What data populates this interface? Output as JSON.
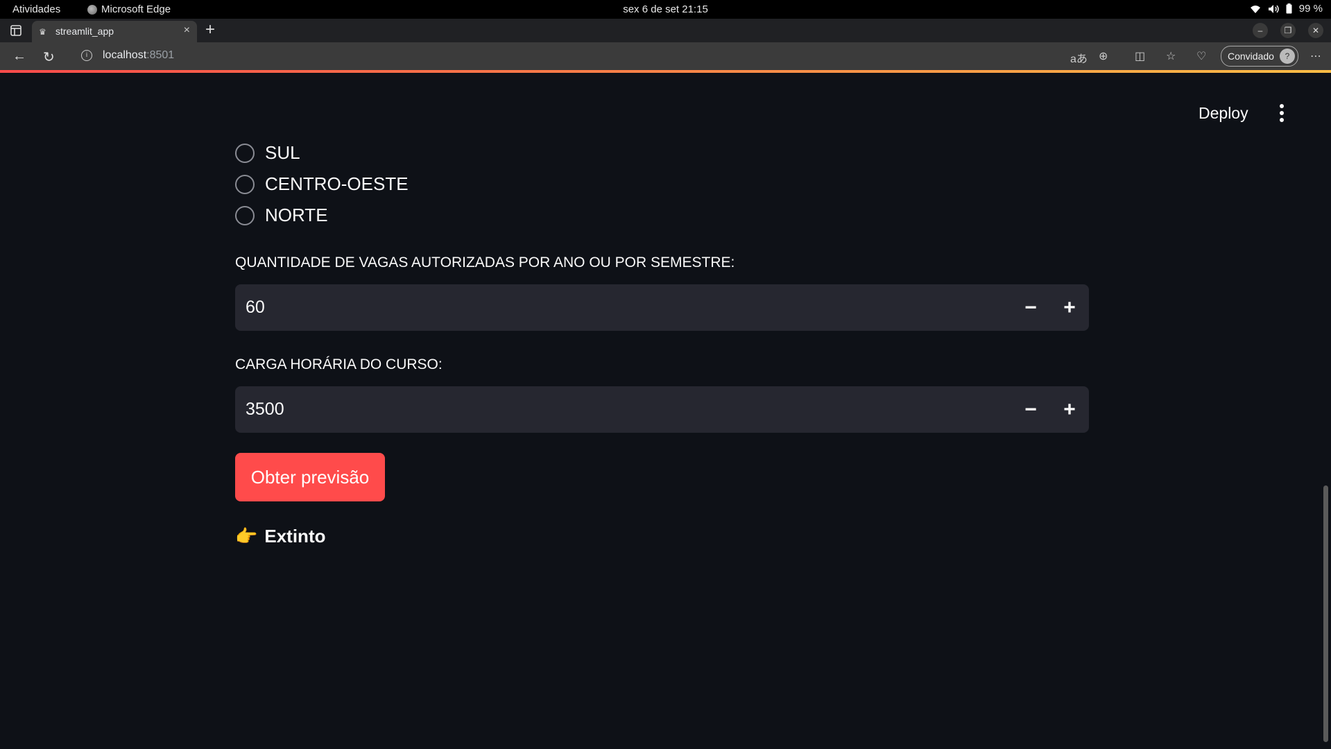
{
  "os_bar": {
    "activities": "Atividades",
    "app_name": "Microsoft Edge",
    "clock": "sex 6 de set  21:15",
    "battery": "99 %"
  },
  "browser": {
    "tab_title": "streamlit_app",
    "url_host": "localhost",
    "url_port": ":8501",
    "profile_label": "Convidado"
  },
  "header": {
    "deploy_label": "Deploy"
  },
  "region_radio": {
    "options": [
      "SUL",
      "CENTRO-OESTE",
      "NORTE"
    ]
  },
  "vagas": {
    "label": "QUANTIDADE DE VAGAS AUTORIZADAS POR ANO OU POR SEMESTRE:",
    "value": "60"
  },
  "carga": {
    "label": "CARGA HORÁRIA DO CURSO:",
    "value": "3500"
  },
  "predict_button": "Obter previsão",
  "result": {
    "emoji": "👉",
    "text": "Extinto"
  },
  "colors": {
    "background": "#0e1117",
    "input_background": "#262730",
    "primary": "#ff4b4b",
    "text": "#fafafa"
  }
}
